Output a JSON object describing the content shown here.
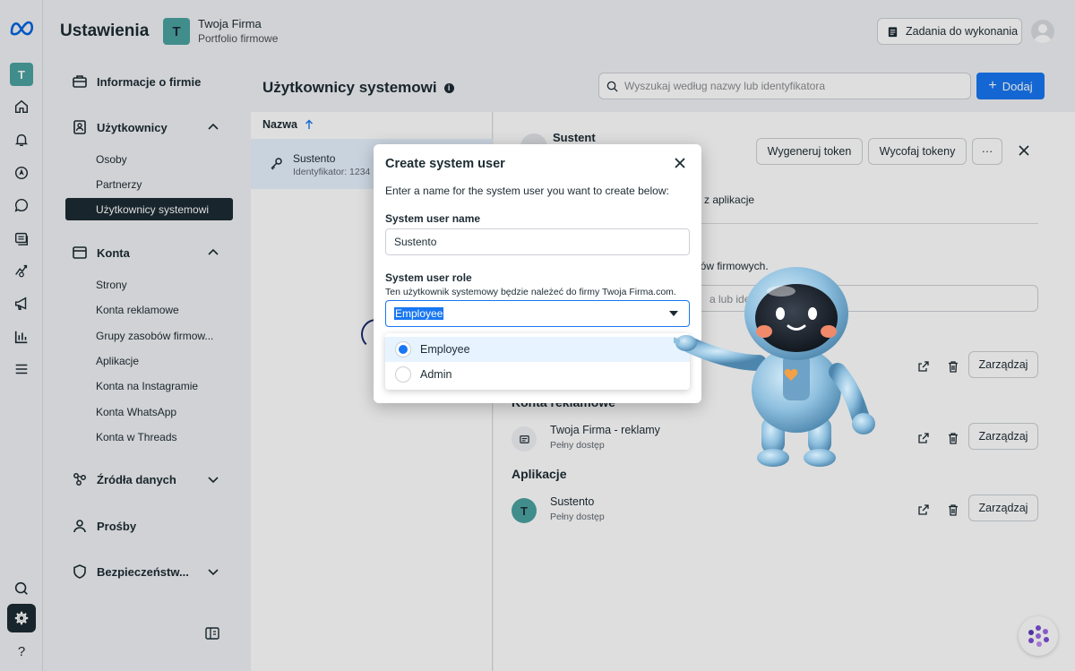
{
  "header": {
    "title": "Ustawienia",
    "business_initial": "T",
    "business_name": "Twoja Firma",
    "business_sub": "Portfolio firmowe",
    "tasks_label": "Zadania do wykonania"
  },
  "rail": {
    "account_initial": "T",
    "help_glyph": "?"
  },
  "sidebar": {
    "sections": [
      {
        "label": "Informacje o firmie",
        "icon": "briefcase-icon"
      },
      {
        "label": "Użytkownicy",
        "icon": "users-icon"
      },
      {
        "label": "Konta",
        "icon": "folder-icon"
      },
      {
        "label": "Źródła danych",
        "icon": "data-sources-icon"
      },
      {
        "label": "Prośby",
        "icon": "person-icon"
      },
      {
        "label": "Bezpieczeństw...",
        "icon": "shield-icon"
      }
    ],
    "users_items": [
      "Osoby",
      "Partnerzy",
      "Użytkownicy systemowi"
    ],
    "accounts_items": [
      "Strony",
      "Konta reklamowe",
      "Grupy zasobów firmow...",
      "Aplikacje",
      "Konta na Instagramie",
      "Konta WhatsApp",
      "Konta w Threads"
    ]
  },
  "main": {
    "page_title": "Użytkownicy systemowi",
    "search_placeholder": "Wyszukaj według nazwy lub identyfikatora",
    "add_label": "Dodaj",
    "list_header": "Nazwa",
    "list_row": {
      "name": "Sustento",
      "id": "Identyfikator: 1234"
    }
  },
  "detail": {
    "name": "Sustent",
    "link_fragment": "e",
    "generate_token": "Wygeneruj token",
    "revoke_tokens": "Wycofaj tokeny",
    "more": "···",
    "note_fragment": "z aplikacje",
    "note2_fragment": "bów firmowych.",
    "input_fragment": "a lub identy",
    "manage_label": "Zarządzaj",
    "sections": {
      "ad_accounts": "Konta reklamowe",
      "apps": "Aplikacje"
    },
    "ad_account": {
      "name": "Twoja Firma - reklamy",
      "access": "Pełny dostęp"
    },
    "app": {
      "initial": "T",
      "name": "Sustento",
      "access": "Pełny dostęp"
    }
  },
  "modal": {
    "title": "Create system user",
    "description": "Enter a name for the system user you want to create below:",
    "name_label": "System user name",
    "name_value": "Sustento",
    "role_label": "System user role",
    "role_help": "Ten użytkownik systemowy będzie należeć do firmy Twoja Firma.com.",
    "role_value": "Employee",
    "options": [
      "Employee",
      "Admin"
    ]
  },
  "colors": {
    "accent": "#1877f2",
    "dark": "#1c2b33",
    "teal": "#4aa3a1"
  }
}
